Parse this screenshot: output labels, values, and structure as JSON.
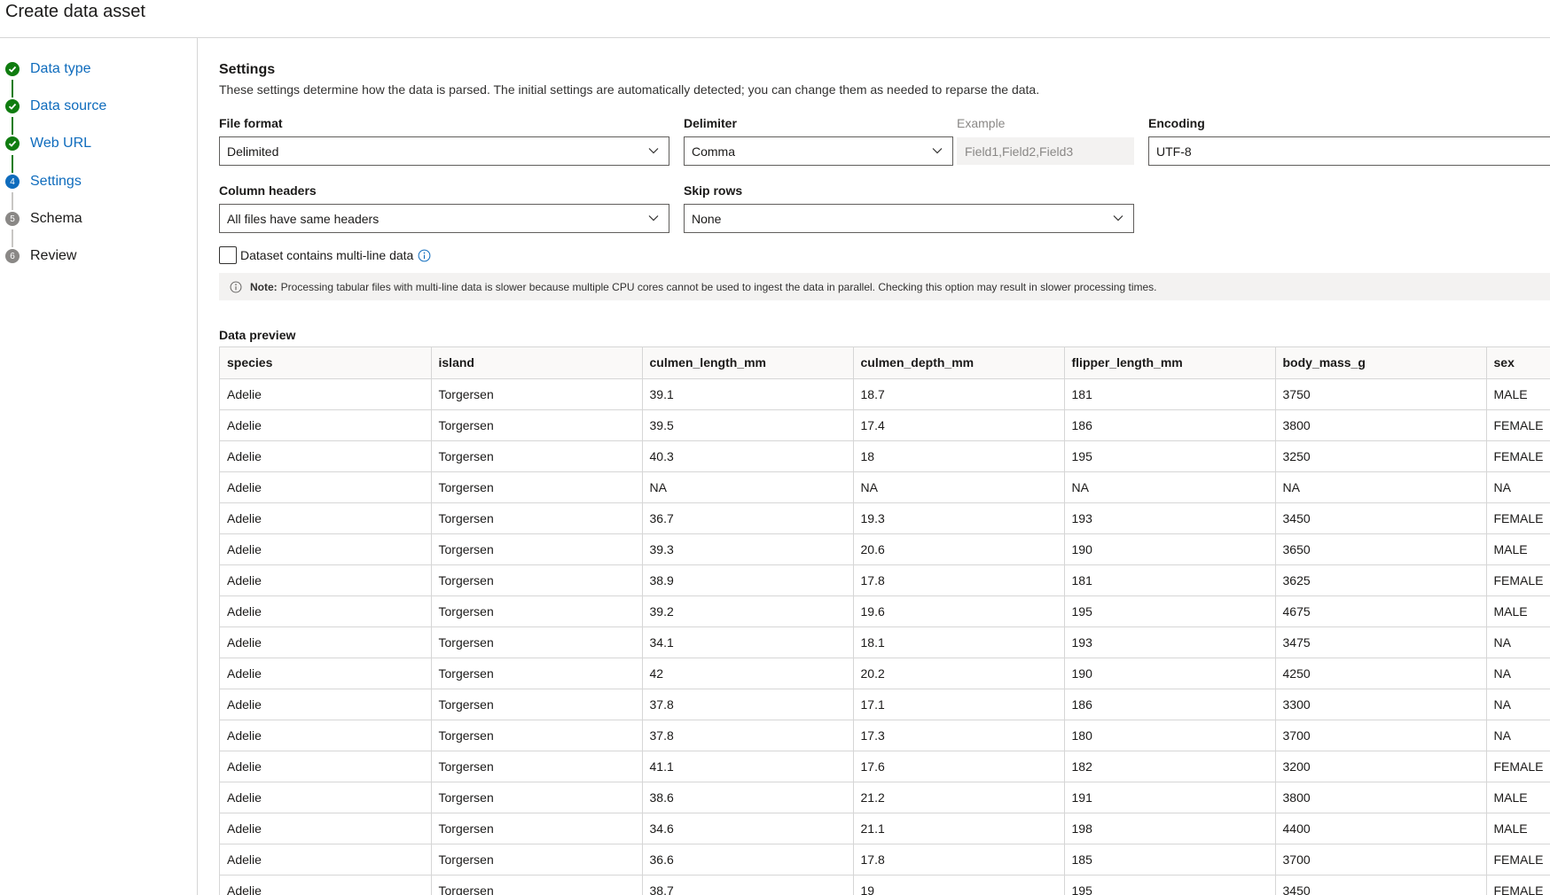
{
  "header": {
    "title": "Create data asset"
  },
  "steps": [
    {
      "num": "1",
      "label": "Data type",
      "state": "done"
    },
    {
      "num": "2",
      "label": "Data source",
      "state": "done"
    },
    {
      "num": "3",
      "label": "Web URL",
      "state": "done"
    },
    {
      "num": "4",
      "label": "Settings",
      "state": "current"
    },
    {
      "num": "5",
      "label": "Schema",
      "state": "pending"
    },
    {
      "num": "6",
      "label": "Review",
      "state": "pending"
    }
  ],
  "settings": {
    "title": "Settings",
    "description": "These settings determine how the data is parsed. The initial settings are automatically detected; you can change them as needed to reparse the data.",
    "file_format": {
      "label": "File format",
      "value": "Delimited"
    },
    "delimiter": {
      "label": "Delimiter",
      "value": "Comma"
    },
    "example": {
      "label": "Example",
      "value": "Field1,Field2,Field3"
    },
    "encoding": {
      "label": "Encoding",
      "value": "UTF-8"
    },
    "column_headers": {
      "label": "Column headers",
      "value": "All files have same headers"
    },
    "skip_rows": {
      "label": "Skip rows",
      "value": "None"
    },
    "multiline": {
      "label": "Dataset contains multi-line data",
      "checked": false
    },
    "note": {
      "prefix": "Note:",
      "text": "Processing tabular files with multi-line data is slower because multiple CPU cores cannot be used to ingest the data in parallel. Checking this option may result in slower processing times."
    }
  },
  "preview": {
    "title": "Data preview",
    "columns": [
      "species",
      "island",
      "culmen_length_mm",
      "culmen_depth_mm",
      "flipper_length_mm",
      "body_mass_g",
      "sex"
    ],
    "rows": [
      [
        "Adelie",
        "Torgersen",
        "39.1",
        "18.7",
        "181",
        "3750",
        "MALE"
      ],
      [
        "Adelie",
        "Torgersen",
        "39.5",
        "17.4",
        "186",
        "3800",
        "FEMALE"
      ],
      [
        "Adelie",
        "Torgersen",
        "40.3",
        "18",
        "195",
        "3250",
        "FEMALE"
      ],
      [
        "Adelie",
        "Torgersen",
        "NA",
        "NA",
        "NA",
        "NA",
        "NA"
      ],
      [
        "Adelie",
        "Torgersen",
        "36.7",
        "19.3",
        "193",
        "3450",
        "FEMALE"
      ],
      [
        "Adelie",
        "Torgersen",
        "39.3",
        "20.6",
        "190",
        "3650",
        "MALE"
      ],
      [
        "Adelie",
        "Torgersen",
        "38.9",
        "17.8",
        "181",
        "3625",
        "FEMALE"
      ],
      [
        "Adelie",
        "Torgersen",
        "39.2",
        "19.6",
        "195",
        "4675",
        "MALE"
      ],
      [
        "Adelie",
        "Torgersen",
        "34.1",
        "18.1",
        "193",
        "3475",
        "NA"
      ],
      [
        "Adelie",
        "Torgersen",
        "42",
        "20.2",
        "190",
        "4250",
        "NA"
      ],
      [
        "Adelie",
        "Torgersen",
        "37.8",
        "17.1",
        "186",
        "3300",
        "NA"
      ],
      [
        "Adelie",
        "Torgersen",
        "37.8",
        "17.3",
        "180",
        "3700",
        "NA"
      ],
      [
        "Adelie",
        "Torgersen",
        "41.1",
        "17.6",
        "182",
        "3200",
        "FEMALE"
      ],
      [
        "Adelie",
        "Torgersen",
        "38.6",
        "21.2",
        "191",
        "3800",
        "MALE"
      ],
      [
        "Adelie",
        "Torgersen",
        "34.6",
        "21.1",
        "198",
        "4400",
        "MALE"
      ],
      [
        "Adelie",
        "Torgersen",
        "36.6",
        "17.8",
        "185",
        "3700",
        "FEMALE"
      ],
      [
        "Adelie",
        "Torgersen",
        "38.7",
        "19",
        "195",
        "3450",
        "FEMALE"
      ]
    ]
  }
}
